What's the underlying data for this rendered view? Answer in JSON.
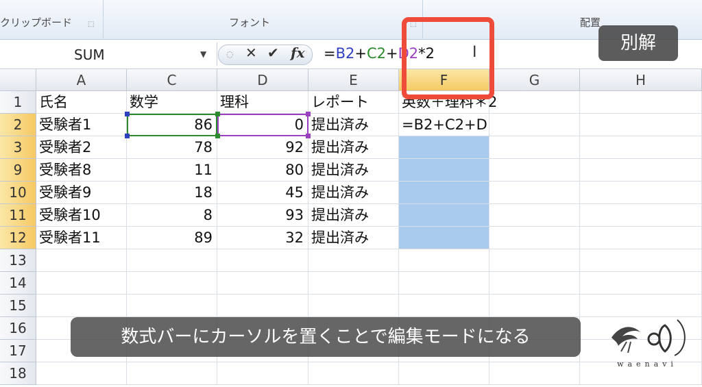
{
  "ribbon": {
    "groups": [
      "クリップボード",
      "フォント",
      "配置"
    ]
  },
  "formula_bar": {
    "name_box": "SUM",
    "formula_parts": [
      {
        "text": "=",
        "color": "#111111"
      },
      {
        "text": "B2",
        "color": "#2b3fbf"
      },
      {
        "text": "+",
        "color": "#111111"
      },
      {
        "text": "C2",
        "color": "#2b8a2b"
      },
      {
        "text": "+",
        "color": "#111111"
      },
      {
        "text": "D2",
        "color": "#9b3fc0"
      },
      {
        "text": "*2",
        "color": "#111111"
      }
    ],
    "cancel_symbol": "✕",
    "enter_symbol": "✔",
    "fx_symbol": "fx"
  },
  "grid": {
    "columns": [
      "A",
      "C",
      "D",
      "E",
      "F",
      "G",
      "H"
    ],
    "selected_column": "F",
    "rows": [
      {
        "num": "1",
        "cells": [
          "氏名",
          "数学",
          "理科",
          "レポート",
          "英数＋理科＊2",
          "",
          ""
        ]
      },
      {
        "num": "2",
        "cells": [
          "受験者1",
          "86",
          "0",
          "提出済み",
          "=B2+C2+D",
          "",
          ""
        ]
      },
      {
        "num": "3",
        "cells": [
          "受験者2",
          "78",
          "92",
          "提出済み",
          "",
          "",
          ""
        ]
      },
      {
        "num": "9",
        "cells": [
          "受験者8",
          "11",
          "80",
          "提出済み",
          "",
          "",
          ""
        ]
      },
      {
        "num": "10",
        "cells": [
          "受験者9",
          "18",
          "45",
          "提出済み",
          "",
          "",
          ""
        ]
      },
      {
        "num": "11",
        "cells": [
          "受験者10",
          "8",
          "93",
          "提出済み",
          "",
          "",
          ""
        ]
      },
      {
        "num": "12",
        "cells": [
          "受験者11",
          "89",
          "32",
          "提出済み",
          "",
          "",
          ""
        ]
      },
      {
        "num": "13",
        "cells": [
          "",
          "",
          "",
          "",
          "",
          "",
          ""
        ]
      },
      {
        "num": "14",
        "cells": [
          "",
          "",
          "",
          "",
          "",
          "",
          ""
        ]
      },
      {
        "num": "15",
        "cells": [
          "",
          "",
          "",
          "",
          "",
          "",
          ""
        ]
      },
      {
        "num": "16",
        "cells": [
          "",
          "",
          "",
          "",
          "",
          "",
          ""
        ]
      },
      {
        "num": "17",
        "cells": [
          "",
          "",
          "",
          "",
          "",
          "",
          ""
        ]
      },
      {
        "num": "18",
        "cells": [
          "",
          "",
          "",
          "",
          "",
          "",
          ""
        ]
      }
    ]
  },
  "overlay": {
    "badge": "別解",
    "caption": "数式バーにカーソルを置くことで編集モードになる",
    "logo_text": "waenavi"
  },
  "colors": {
    "highlight_box": "#ee4b3a",
    "selected_range": "#a9cbee"
  }
}
